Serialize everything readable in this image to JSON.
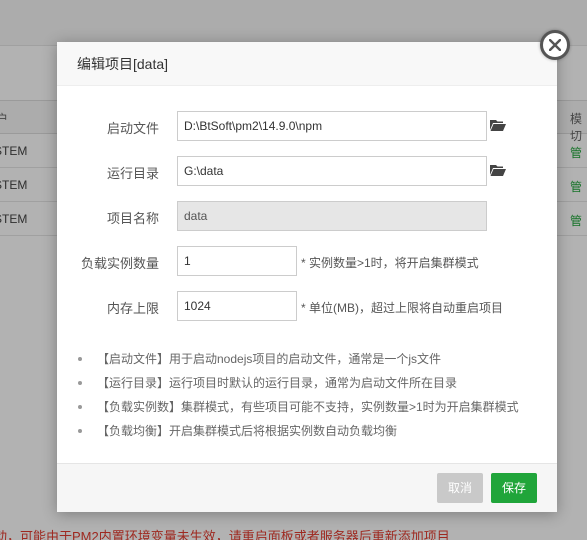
{
  "background": {
    "table_header": {
      "col1": "户",
      "col2": "模切"
    },
    "rows": [
      {
        "col1": "STEM",
        "col2": "管"
      },
      {
        "col1": "STEM",
        "col2": "管"
      },
      {
        "col1": "STEM",
        "col2": "管"
      }
    ],
    "warning": "动，可能由于PM2内置环境变量未生效，请重启面板或者服务器后重新添加项目"
  },
  "dialog": {
    "title": "编辑项目[data]",
    "fields": {
      "start_file": {
        "label": "启动文件",
        "value": "D:\\BtSoft\\pm2\\14.9.0\\npm"
      },
      "run_dir": {
        "label": "运行目录",
        "value": "G:\\data"
      },
      "project_name": {
        "label": "项目名称",
        "value": "data"
      },
      "instances": {
        "label": "负载实例数量",
        "value": "1",
        "hint": "* 实例数量>1时，将开启集群模式"
      },
      "memory": {
        "label": "内存上限",
        "value": "1024",
        "hint": "* 单位(MB)，超过上限将自动重启项目"
      }
    },
    "tips": [
      "【启动文件】用于启动nodejs项目的启动文件，通常是一个js文件",
      "【运行目录】运行项目时默认的运行目录，通常为启动文件所在目录",
      "【负载实例数】集群模式，有些项目可能不支持，实例数量>1时为开启集群模式",
      "【负载均衡】开启集群模式后将根据实例数自动负载均衡"
    ],
    "buttons": {
      "cancel": "取消",
      "save": "保存"
    }
  },
  "colors": {
    "accent": "#20a53a",
    "warning": "#e33b2f",
    "cancel": "#c9c9c9"
  },
  "icons": {
    "folder": "folder-open-icon",
    "close": "close-icon"
  }
}
